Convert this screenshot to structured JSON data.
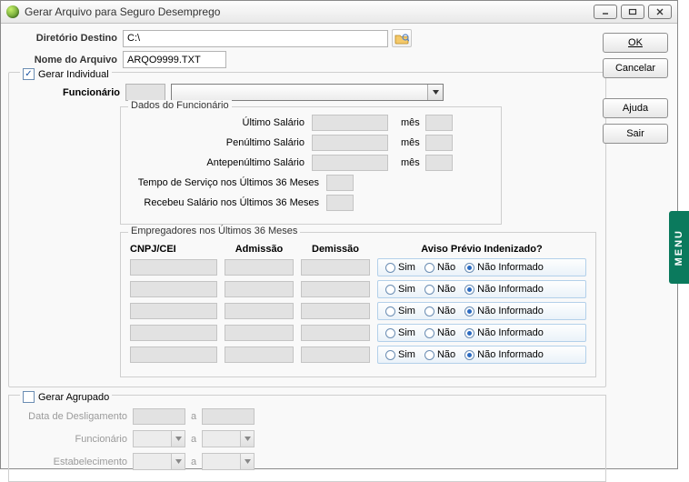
{
  "window": {
    "title": "Gerar Arquivo para Seguro Desemprego"
  },
  "buttons": {
    "ok": "OK",
    "cancel": "Cancelar",
    "help": "Ajuda",
    "exit": "Sair"
  },
  "menu_tab": "MENU",
  "form": {
    "dir_label": "Diretório Destino",
    "dir_value": "C:\\",
    "file_label": "Nome do Arquivo",
    "file_value": "ARQO9999.TXT",
    "gerar_individual_label": "Gerar Individual",
    "gerar_individual_checked": true,
    "funcionario_label": "Funcionário",
    "funcionario_code": "",
    "funcionario_name": "",
    "dados_legend": "Dados do Funcionário",
    "ultimo_salario_label": "Último Salário",
    "penultimo_salario_label": "Penúltimo Salário",
    "antepenultimo_salario_label": "Antepenúltimo Salário",
    "mes_label": "mês",
    "tempo_servico_label": "Tempo de Serviço nos Últimos 36 Meses",
    "recebeu_salario_label": "Recebeu Salário nos Últimos 36 Meses",
    "emp_legend": "Empregadores nos Últimos 36 Meses",
    "col_cnpj": "CNPJ/CEI",
    "col_adm": "Admissão",
    "col_dem": "Demissão",
    "col_aviso": "Aviso Prévio Indenizado?",
    "radio_sim": "Sim",
    "radio_nao": "Não",
    "radio_nao_inf": "Não Informado",
    "gerar_agrupado_label": "Gerar Agrupado",
    "gerar_agrupado_checked": false,
    "data_deslig_label": "Data de Desligamento",
    "funcionario2_label": "Funcionário",
    "estab_label": "Estabelecimento",
    "a_label": "a"
  }
}
